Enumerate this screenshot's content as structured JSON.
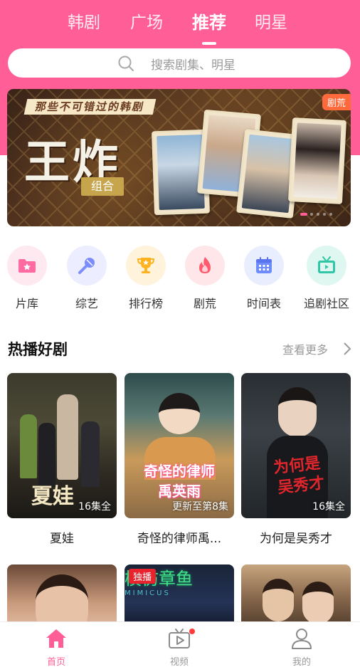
{
  "top_tabs": [
    {
      "label": "韩剧"
    },
    {
      "label": "广场"
    },
    {
      "label": "推荐",
      "active": true
    },
    {
      "label": "明星"
    }
  ],
  "search": {
    "placeholder": "搜索剧集、明星"
  },
  "banner": {
    "ribbon": "那些不可错过的韩剧",
    "title": "王炸",
    "subtitle": "组合",
    "tag": "剧荒",
    "slide_count": 5,
    "active_slide": 1
  },
  "categories": [
    {
      "label": "片库",
      "icon": "folder-star-icon",
      "color": "#ff6aa0",
      "bg": "#ffe9f1"
    },
    {
      "label": "综艺",
      "icon": "microphone-icon",
      "color": "#7b8cff",
      "bg": "#eceeff"
    },
    {
      "label": "排行榜",
      "icon": "trophy-icon",
      "color": "#ffb21e",
      "bg": "#fff3dc"
    },
    {
      "label": "剧荒",
      "icon": "flame-icon",
      "color": "#ff5a6e",
      "bg": "#ffe6e9"
    },
    {
      "label": "时间表",
      "icon": "calendar-icon",
      "color": "#6f8cff",
      "bg": "#e9eeff"
    },
    {
      "label": "追剧社区",
      "icon": "tv-icon",
      "color": "#2fc7a6",
      "bg": "#dff7f1"
    }
  ],
  "hot_section": {
    "title": "热播好剧",
    "more_label": "查看更多"
  },
  "shows": [
    {
      "title": "夏娃",
      "badge": "16集全",
      "poster_text": "夏娃"
    },
    {
      "title": "奇怪的律师禹...",
      "badge": "更新至第8集",
      "poster_text_1": "奇怪的律师",
      "poster_text_2": "禹英雨"
    },
    {
      "title": "为何是吴秀才",
      "badge": "16集全",
      "poster_text_1": "为何是",
      "poster_text_2": "吴秀才"
    }
  ],
  "shows_row2": [
    {
      "label": ""
    },
    {
      "exclusive": "独播",
      "poster_text": "模仿章鱼",
      "poster_sub": "MIMICUS"
    },
    {
      "label": ""
    }
  ],
  "bottom_nav": [
    {
      "label": "首页",
      "icon": "home-icon",
      "active": true
    },
    {
      "label": "视频",
      "icon": "video-tv-icon",
      "has_dot": true
    },
    {
      "label": "我的",
      "icon": "profile-icon"
    }
  ],
  "colors": {
    "brand": "#ff5f96",
    "muted": "#9a9a9a"
  }
}
